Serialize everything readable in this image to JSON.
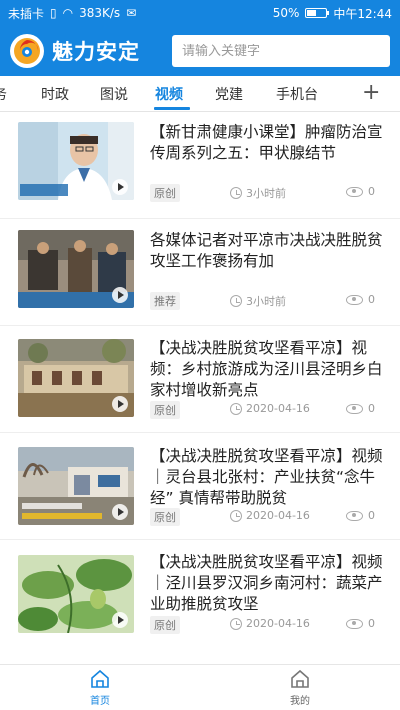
{
  "status_bar": {
    "carrier": "未插卡",
    "speed": "383K/s",
    "battery_percent": "50%",
    "battery_level": 0.5,
    "time": "中午12:44"
  },
  "header": {
    "app_name": "魅力安定",
    "search_placeholder": "请输入关键字"
  },
  "tabs": [
    {
      "label": "务"
    },
    {
      "label": "时政"
    },
    {
      "label": "图说"
    },
    {
      "label": "视频",
      "active": true
    },
    {
      "label": "党建"
    },
    {
      "label": "手机台"
    }
  ],
  "accent_color": "#1585df",
  "news": [
    {
      "title": "【新甘肃健康小课堂】肿瘤防治宣传周系列之五：甲状腺结节",
      "tag": "原创",
      "time": "3小时前",
      "views": "0"
    },
    {
      "title": "各媒体记者对平凉市决战决胜脱贫攻坚工作褒扬有加",
      "tag": "推荐",
      "time": "3小时前",
      "views": "0"
    },
    {
      "title": "【决战决胜脱贫攻坚看平凉】视频：乡村旅游成为泾川县泾明乡白家村增收新亮点",
      "tag": "原创",
      "time": "2020-04-16",
      "views": "0"
    },
    {
      "title": "【决战决胜脱贫攻坚看平凉】视频｜灵台县北张村：产业扶贫“念牛经” 真情帮带助脱贫",
      "tag": "原创",
      "time": "2020-04-16",
      "views": "0"
    },
    {
      "title": "【决战决胜脱贫攻坚看平凉】视频｜泾川县罗汉洞乡南河村：蔬菜产业助推脱贫攻坚",
      "tag": "原创",
      "time": "2020-04-16",
      "views": "0"
    }
  ],
  "bottom_nav": {
    "home_label": "首页",
    "mine_label": "我的"
  }
}
